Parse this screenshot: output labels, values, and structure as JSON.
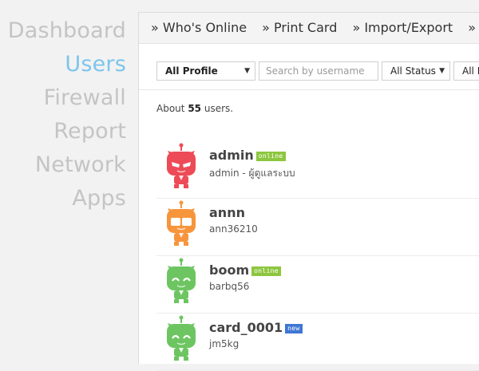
{
  "nav": {
    "items": [
      {
        "label": "Dashboard",
        "active": false
      },
      {
        "label": "Users",
        "active": true
      },
      {
        "label": "Firewall",
        "active": false
      },
      {
        "label": "Report",
        "active": false
      },
      {
        "label": "Network",
        "active": false
      },
      {
        "label": "Apps",
        "active": false
      }
    ]
  },
  "tabs": [
    {
      "label": "» Who's Online"
    },
    {
      "label": "» Print Card"
    },
    {
      "label": "» Import/Export"
    },
    {
      "label": "» Profil"
    }
  ],
  "filters": {
    "profile_value": "All Profile",
    "search_placeholder": "Search by username",
    "status_value": "All Status",
    "fourth_value": "All R"
  },
  "summary": {
    "prefix": "About",
    "count": "55",
    "suffix": "users."
  },
  "users": [
    {
      "name": "admin",
      "badge": "online",
      "badge_color": "#8dc63f",
      "sub": "admin - ผู้ดูแลระบบ",
      "avatar": "red-robot-icon",
      "avatar_color": "#ec4b57"
    },
    {
      "name": "annn",
      "badge": "",
      "badge_color": "",
      "sub": "ann36210",
      "avatar": "orange-robot-icon",
      "avatar_color": "#f7953d"
    },
    {
      "name": "boom",
      "badge": "online",
      "badge_color": "#8dc63f",
      "sub": "barbq56",
      "avatar": "green-robot-icon",
      "avatar_color": "#6dc561"
    },
    {
      "name": "card_0001",
      "badge": "new",
      "badge_color": "#3f77d4",
      "sub": "jm5kg",
      "avatar": "green-robot-icon",
      "avatar_color": "#6dc561"
    }
  ],
  "colors": {
    "nav_active": "#7cc5ec",
    "nav_inactive": "#c4c4c4"
  }
}
